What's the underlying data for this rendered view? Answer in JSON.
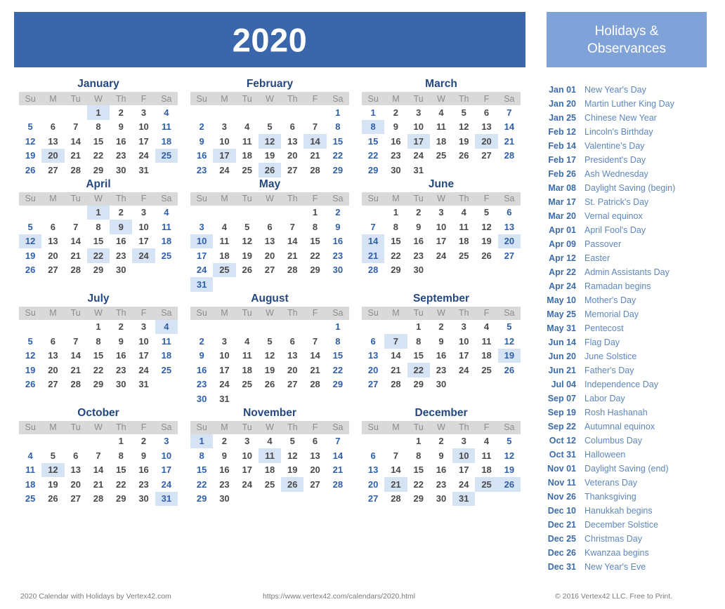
{
  "header": {
    "year_title": "2020"
  },
  "holidays_panel": {
    "title_line1": "Holidays &",
    "title_line2": "Observances",
    "items": [
      {
        "date": "Jan 01",
        "name": "New Year's Day"
      },
      {
        "date": "Jan 20",
        "name": "Martin Luther King Day"
      },
      {
        "date": "Jan 25",
        "name": "Chinese New Year"
      },
      {
        "date": "Feb 12",
        "name": "Lincoln's Birthday"
      },
      {
        "date": "Feb 14",
        "name": "Valentine's Day"
      },
      {
        "date": "Feb 17",
        "name": "President's Day"
      },
      {
        "date": "Feb 26",
        "name": "Ash Wednesday"
      },
      {
        "date": "Mar 08",
        "name": "Daylight Saving (begin)"
      },
      {
        "date": "Mar 17",
        "name": "St. Patrick's Day"
      },
      {
        "date": "Mar 20",
        "name": "Vernal equinox"
      },
      {
        "date": "Apr 01",
        "name": "April Fool's Day"
      },
      {
        "date": "Apr 09",
        "name": "Passover"
      },
      {
        "date": "Apr 12",
        "name": "Easter"
      },
      {
        "date": "Apr 22",
        "name": "Admin Assistants Day"
      },
      {
        "date": "Apr 24",
        "name": "Ramadan begins"
      },
      {
        "date": "May 10",
        "name": "Mother's Day"
      },
      {
        "date": "May 25",
        "name": "Memorial Day"
      },
      {
        "date": "May 31",
        "name": "Pentecost"
      },
      {
        "date": "Jun 14",
        "name": "Flag Day"
      },
      {
        "date": "Jun 20",
        "name": "June Solstice"
      },
      {
        "date": "Jun 21",
        "name": "Father's Day"
      },
      {
        "date": "Jul 04",
        "name": "Independence Day"
      },
      {
        "date": "Sep 07",
        "name": "Labor Day"
      },
      {
        "date": "Sep 19",
        "name": "Rosh Hashanah"
      },
      {
        "date": "Sep 22",
        "name": "Autumnal equinox"
      },
      {
        "date": "Oct 12",
        "name": "Columbus Day"
      },
      {
        "date": "Oct 31",
        "name": "Halloween"
      },
      {
        "date": "Nov 01",
        "name": "Daylight Saving (end)"
      },
      {
        "date": "Nov 11",
        "name": "Veterans Day"
      },
      {
        "date": "Nov 26",
        "name": "Thanksgiving"
      },
      {
        "date": "Dec 10",
        "name": "Hanukkah begins"
      },
      {
        "date": "Dec 21",
        "name": "December Solstice"
      },
      {
        "date": "Dec 25",
        "name": "Christmas Day"
      },
      {
        "date": "Dec 26",
        "name": "Kwanzaa begins"
      },
      {
        "date": "Dec 31",
        "name": "New Year's Eve"
      }
    ]
  },
  "calendar": {
    "weekday_headers": [
      "Su",
      "M",
      "Tu",
      "W",
      "Th",
      "F",
      "Sa"
    ],
    "months": [
      {
        "name": "January",
        "days_in_month": 31,
        "first_weekday": 3,
        "highlighted": [
          1,
          20,
          25
        ]
      },
      {
        "name": "February",
        "days_in_month": 29,
        "first_weekday": 6,
        "highlighted": [
          12,
          14,
          17,
          26
        ]
      },
      {
        "name": "March",
        "days_in_month": 31,
        "first_weekday": 0,
        "highlighted": [
          8,
          17,
          20
        ]
      },
      {
        "name": "April",
        "days_in_month": 30,
        "first_weekday": 3,
        "highlighted": [
          1,
          9,
          12,
          22,
          24
        ]
      },
      {
        "name": "May",
        "days_in_month": 31,
        "first_weekday": 5,
        "highlighted": [
          10,
          25,
          31
        ]
      },
      {
        "name": "June",
        "days_in_month": 30,
        "first_weekday": 1,
        "highlighted": [
          14,
          20,
          21
        ]
      },
      {
        "name": "July",
        "days_in_month": 31,
        "first_weekday": 3,
        "highlighted": [
          4
        ]
      },
      {
        "name": "August",
        "days_in_month": 31,
        "first_weekday": 6,
        "highlighted": []
      },
      {
        "name": "September",
        "days_in_month": 30,
        "first_weekday": 2,
        "highlighted": [
          7,
          19,
          22
        ]
      },
      {
        "name": "October",
        "days_in_month": 31,
        "first_weekday": 4,
        "highlighted": [
          12,
          31
        ]
      },
      {
        "name": "November",
        "days_in_month": 30,
        "first_weekday": 0,
        "highlighted": [
          1,
          11,
          26
        ]
      },
      {
        "name": "December",
        "days_in_month": 31,
        "first_weekday": 2,
        "highlighted": [
          10,
          21,
          25,
          26,
          31
        ]
      }
    ]
  },
  "footer": {
    "left": "2020 Calendar with Holidays by Vertex42.com",
    "middle": "https://www.vertex42.com/calendars/2020.html",
    "right": "© 2016 Vertex42 LLC. Free to Print."
  },
  "colors": {
    "year_banner": "#3a67ab",
    "holidays_banner": "#7fa3d8",
    "month_title": "#24487f",
    "weekday_band": "#d9d9d9",
    "highlight_cell": "#d6e3f5",
    "weekend_text": "#2f5fa8",
    "weekday_text": "#4a4a4a",
    "holiday_date": "#3c6ca8",
    "holiday_name": "#5d87bf"
  }
}
